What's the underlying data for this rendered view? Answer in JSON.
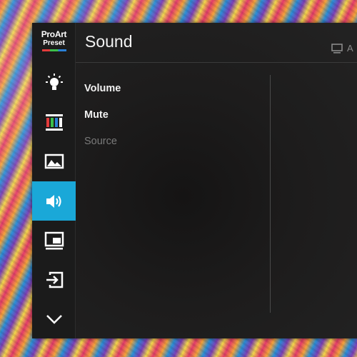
{
  "logo": {
    "line1": "ProArt",
    "line2": "Preset"
  },
  "panel": {
    "title": "Sound"
  },
  "input_indicator": {
    "icon": "monitor-icon",
    "label": "A"
  },
  "sidebar": {
    "items": [
      {
        "name": "bluelight-filter",
        "icon": "lightbulb-icon",
        "active": false
      },
      {
        "name": "color",
        "icon": "color-bars-icon",
        "active": false
      },
      {
        "name": "image",
        "icon": "image-icon",
        "active": false
      },
      {
        "name": "sound",
        "icon": "speaker-icon",
        "active": true
      },
      {
        "name": "pip-pbp",
        "icon": "pip-icon",
        "active": false
      },
      {
        "name": "input-select",
        "icon": "input-icon",
        "active": false
      },
      {
        "name": "more",
        "icon": "chevron-down-icon",
        "active": false
      }
    ]
  },
  "menu": {
    "items": [
      {
        "label": "Volume",
        "enabled": true
      },
      {
        "label": "Mute",
        "enabled": true
      },
      {
        "label": "Source",
        "enabled": false
      }
    ]
  },
  "colors": {
    "accent": "#1aa8d8",
    "panel": "#1d1c1c",
    "text": "#f0f0f0",
    "disabled": "#7a7a7a"
  }
}
